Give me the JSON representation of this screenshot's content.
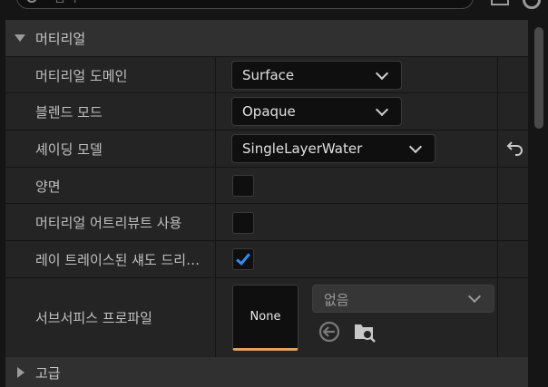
{
  "search": {
    "placeholder": "검색"
  },
  "toolbar": {
    "grid_icon": "grid-icon",
    "settings_icon": "gear-icon"
  },
  "categories": {
    "material": {
      "label": "머티리얼",
      "expanded": true
    },
    "advanced": {
      "label": "고급",
      "expanded": false
    }
  },
  "properties": {
    "material_domain": {
      "label": "머티리얼 도메인",
      "value": "Surface"
    },
    "blend_mode": {
      "label": "블렌드 모드",
      "value": "Opaque"
    },
    "shading_model": {
      "label": "셰이딩 모델",
      "value": "SingleLayerWater"
    },
    "two_sided": {
      "label": "양면",
      "checked": false
    },
    "use_material_attributes": {
      "label": "머티리얼 어트리뷰트 사용",
      "checked": false
    },
    "raytraced_shadows": {
      "label": "레이 트레이스된 섀도 드리…",
      "checked": true
    },
    "subsurface_profile": {
      "label": "서브서피스 프로파일",
      "thumbnail": "None",
      "asset": "없음"
    }
  },
  "colors": {
    "accent": "#2f8cf0",
    "thumb_underline": "#e0a060",
    "panel_bg": "#242424",
    "category_bg": "#303030"
  }
}
